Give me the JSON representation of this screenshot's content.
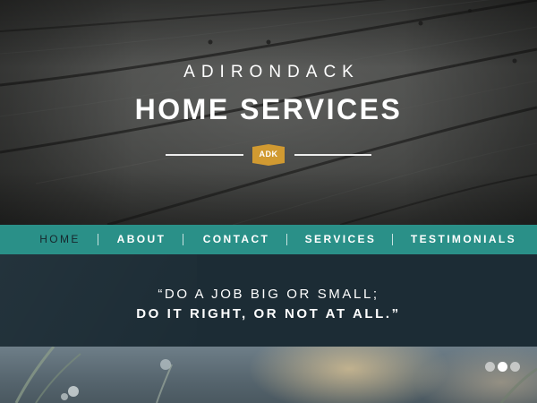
{
  "hero": {
    "brand_line1": "ADIRONDACK",
    "brand_line2": "HOME SERVICES",
    "badge_text": "ADK",
    "badge_color": "#d19a31"
  },
  "nav": {
    "items": [
      {
        "label": "HOME",
        "active": true
      },
      {
        "label": "ABOUT",
        "active": false
      },
      {
        "label": "CONTACT",
        "active": false
      },
      {
        "label": "SERVICES",
        "active": false
      },
      {
        "label": "TESTIMONIALS",
        "active": false
      }
    ],
    "background": "#2a9088"
  },
  "quote": {
    "line1": "“DO A JOB BIG OR SMALL;",
    "line2": "DO IT RIGHT, OR NOT AT ALL.”",
    "background": "#1c2c35"
  },
  "slider": {
    "dot_count": 3,
    "active_index": 1
  }
}
